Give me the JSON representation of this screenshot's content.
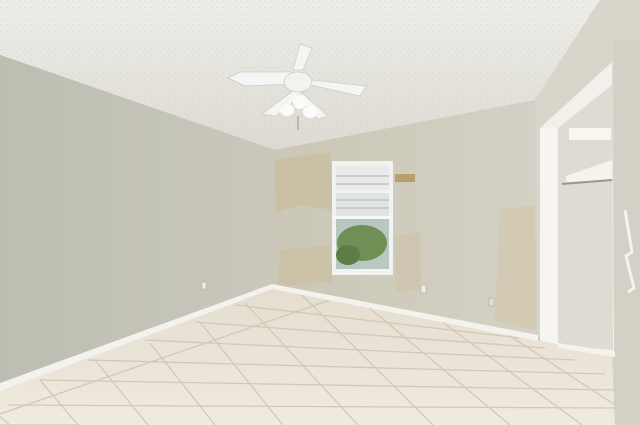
{
  "scene": {
    "description_visible_text": [],
    "colors": {
      "ceiling": "#e9e8e2",
      "ceiling_shadow": "#d6d4cc",
      "left_wall": "#c2c2b6",
      "back_wall": "#cfcdc2",
      "back_wall_stain": "#c7b99a",
      "right_wall": "#d8d5cb",
      "floor_tile": "#ebe4d8",
      "floor_grout": "#d2c8b8",
      "baseboard": "#f4f2ec",
      "window_frame": "#f2f2f0",
      "window_glass": "#b9c7c2",
      "window_tree": "#6f8f55",
      "closet_interior": "#dedbd2",
      "fan_body": "#f5f5f3"
    }
  }
}
